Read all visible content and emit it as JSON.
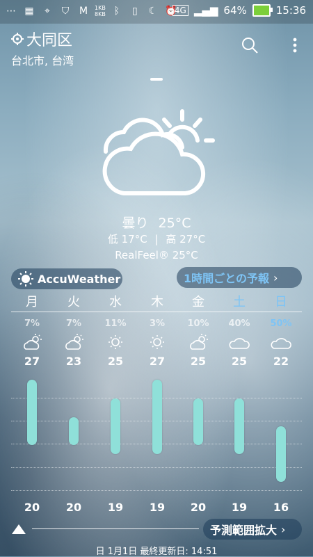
{
  "status": {
    "net_speed_up": "1KB",
    "net_speed_down": "8KB",
    "network": "4G",
    "battery": "64%",
    "time": "15:36"
  },
  "location": {
    "name": "大同区",
    "sub": "台北市, 台湾"
  },
  "current": {
    "condition": "曇り",
    "temp": "25°C",
    "low_label": "低",
    "low": "17°C",
    "high_label": "高",
    "high": "27°C",
    "realfeel": "RealFeel® 25°C"
  },
  "accuweather_label": "AccuWeather",
  "hourly_button": "1時間ごとの予報",
  "expand_button": "予測範囲拡大",
  "footer": "日 1月1日 最終更新日: 14:51",
  "colors": {
    "bar": "#8fe0d9",
    "weekend": "#7ec4f5",
    "sunday_pct": "#7ec4f5"
  },
  "days": [
    {
      "name": "月",
      "precip": "7%",
      "icon": "partly-cloudy-icon",
      "high": "27",
      "low": "20"
    },
    {
      "name": "火",
      "precip": "7%",
      "icon": "partly-cloudy-icon",
      "high": "23",
      "low": "20"
    },
    {
      "name": "水",
      "precip": "11%",
      "icon": "sun-icon",
      "high": "25",
      "low": "19"
    },
    {
      "name": "木",
      "precip": "3%",
      "icon": "sun-icon",
      "high": "27",
      "low": "19"
    },
    {
      "name": "金",
      "precip": "10%",
      "icon": "partly-cloudy-icon",
      "high": "25",
      "low": "20"
    },
    {
      "name": "土",
      "precip": "40%",
      "icon": "cloud-icon",
      "high": "25",
      "low": "19"
    },
    {
      "name": "日",
      "precip": "50%",
      "icon": "cloud-icon",
      "high": "22",
      "low": "16"
    }
  ]
}
